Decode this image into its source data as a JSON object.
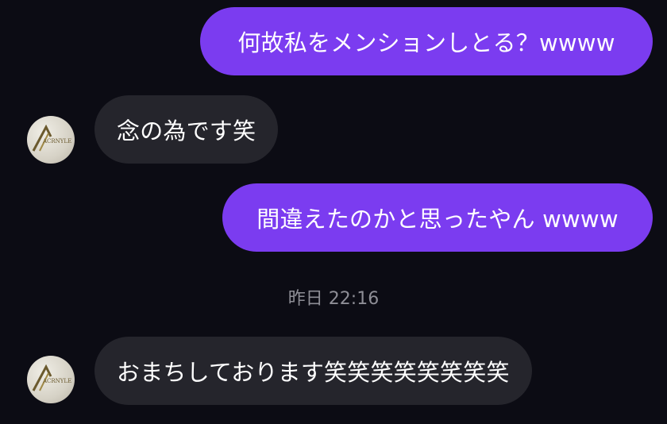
{
  "messages": [
    {
      "id": "m1",
      "direction": "outgoing",
      "text": "何故私をメンションしとる？wwww"
    },
    {
      "id": "m2",
      "direction": "incoming",
      "text": "念の為です笑"
    },
    {
      "id": "m3",
      "direction": "outgoing",
      "text": "間違えたのかと思ったやん wwww"
    },
    {
      "id": "m4",
      "direction": "incoming",
      "text": "おまちしております笑笑笑笑笑笑笑笑"
    }
  ],
  "timestamp_separator": "昨日 22:16",
  "avatar": {
    "icon": "logo-avatar-icon",
    "logo_text": "ACRNYLE"
  },
  "colors": {
    "background": "#0c0c14",
    "outgoing_bubble": "#7b3cf0",
    "incoming_bubble": "#25252c",
    "text": "#ffffff",
    "timestamp": "#8e8e96"
  }
}
